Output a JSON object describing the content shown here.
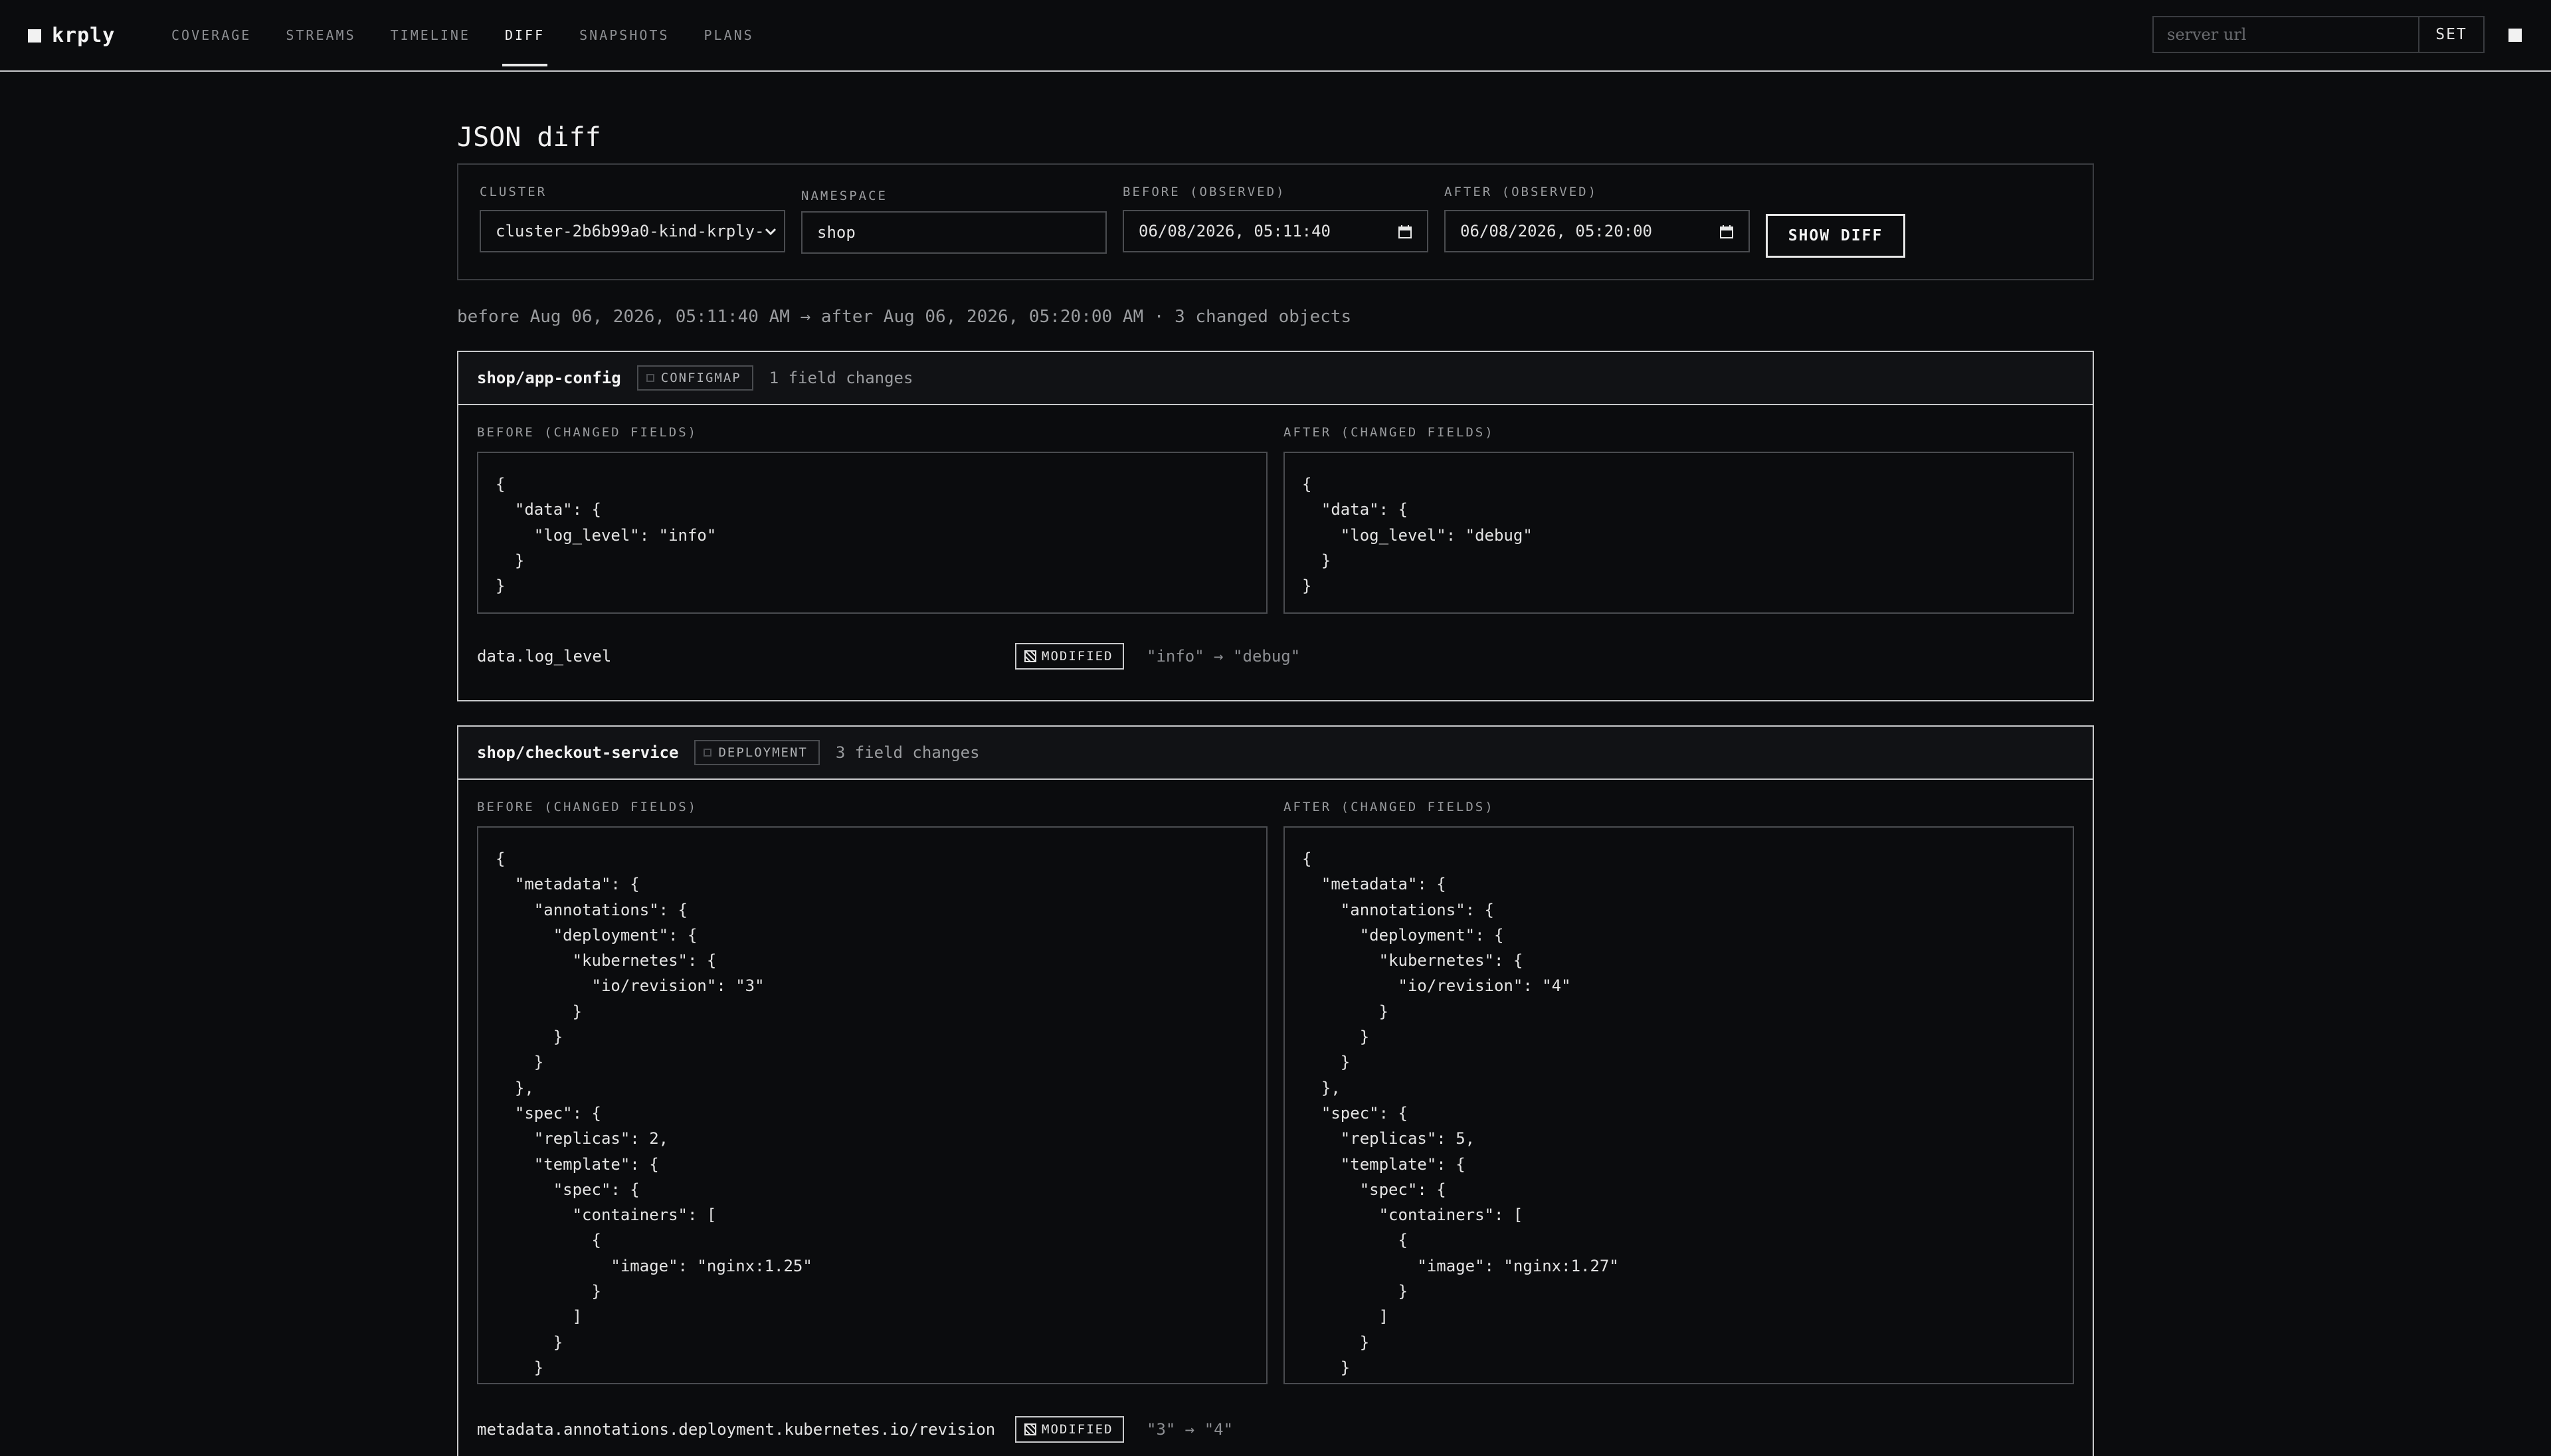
{
  "app": {
    "name": "krply"
  },
  "nav": {
    "items": [
      "COVERAGE",
      "STREAMS",
      "TIMELINE",
      "DIFF",
      "SNAPSHOTS",
      "PLANS"
    ],
    "active": "DIFF"
  },
  "server": {
    "placeholder": "server url",
    "set_label": "SET"
  },
  "page": {
    "title": "JSON diff"
  },
  "filters": {
    "cluster_label": "CLUSTER",
    "cluster_value": "cluster-2b6b99a0-kind-krply-",
    "namespace_label": "NAMESPACE",
    "namespace_value": "shop",
    "before_label": "BEFORE (OBSERVED)",
    "before_value": "06/08/2026, 05:11:40",
    "after_label": "AFTER (OBSERVED)",
    "after_value": "06/08/2026, 05:20:00",
    "show_label": "SHOW DIFF"
  },
  "summary": "before Aug 06, 2026, 05:11:40 AM → after Aug 06, 2026, 05:20:00 AM · 3 changed objects",
  "objects": [
    {
      "name": "shop/app-config",
      "kind": "CONFIGMAP",
      "changes": "1 field changes",
      "before_label": "BEFORE (CHANGED FIELDS)",
      "after_label": "AFTER (CHANGED FIELDS)",
      "before_json": [
        "{",
        "  \"data\": {",
        "    \"log_level\": \"info\"",
        "  }",
        "}"
      ],
      "after_json": [
        "{",
        "  \"data\": {",
        "    \"log_level\": \"debug\"",
        "  }",
        "}"
      ],
      "field_changes": [
        {
          "path": "data.log_level",
          "type": "MODIFIED",
          "values": "\"info\" → \"debug\""
        }
      ]
    },
    {
      "name": "shop/checkout-service",
      "kind": "DEPLOYMENT",
      "changes": "3 field changes",
      "before_label": "BEFORE (CHANGED FIELDS)",
      "after_label": "AFTER (CHANGED FIELDS)",
      "before_json": [
        "{",
        "  \"metadata\": {",
        "    \"annotations\": {",
        "      \"deployment\": {",
        "        \"kubernetes\": {",
        "          \"io/revision\": \"3\"",
        "        }",
        "      }",
        "    }",
        "  },",
        "  \"spec\": {",
        "    \"replicas\": 2,",
        "    \"template\": {",
        "      \"spec\": {",
        "        \"containers\": [",
        "          {",
        "            \"image\": \"nginx:1.25\"",
        "          }",
        "        ]",
        "      }",
        "    }"
      ],
      "after_json": [
        "{",
        "  \"metadata\": {",
        "    \"annotations\": {",
        "      \"deployment\": {",
        "        \"kubernetes\": {",
        "          \"io/revision\": \"4\"",
        "        }",
        "      }",
        "    }",
        "  },",
        "  \"spec\": {",
        "    \"replicas\": 5,",
        "    \"template\": {",
        "      \"spec\": {",
        "        \"containers\": [",
        "          {",
        "            \"image\": \"nginx:1.27\"",
        "          }",
        "        ]",
        "      }",
        "    }"
      ],
      "field_changes": [
        {
          "path": "metadata.annotations.deployment.kubernetes.io/revision",
          "type": "MODIFIED",
          "values": "\"3\" → \"4\""
        }
      ]
    }
  ]
}
